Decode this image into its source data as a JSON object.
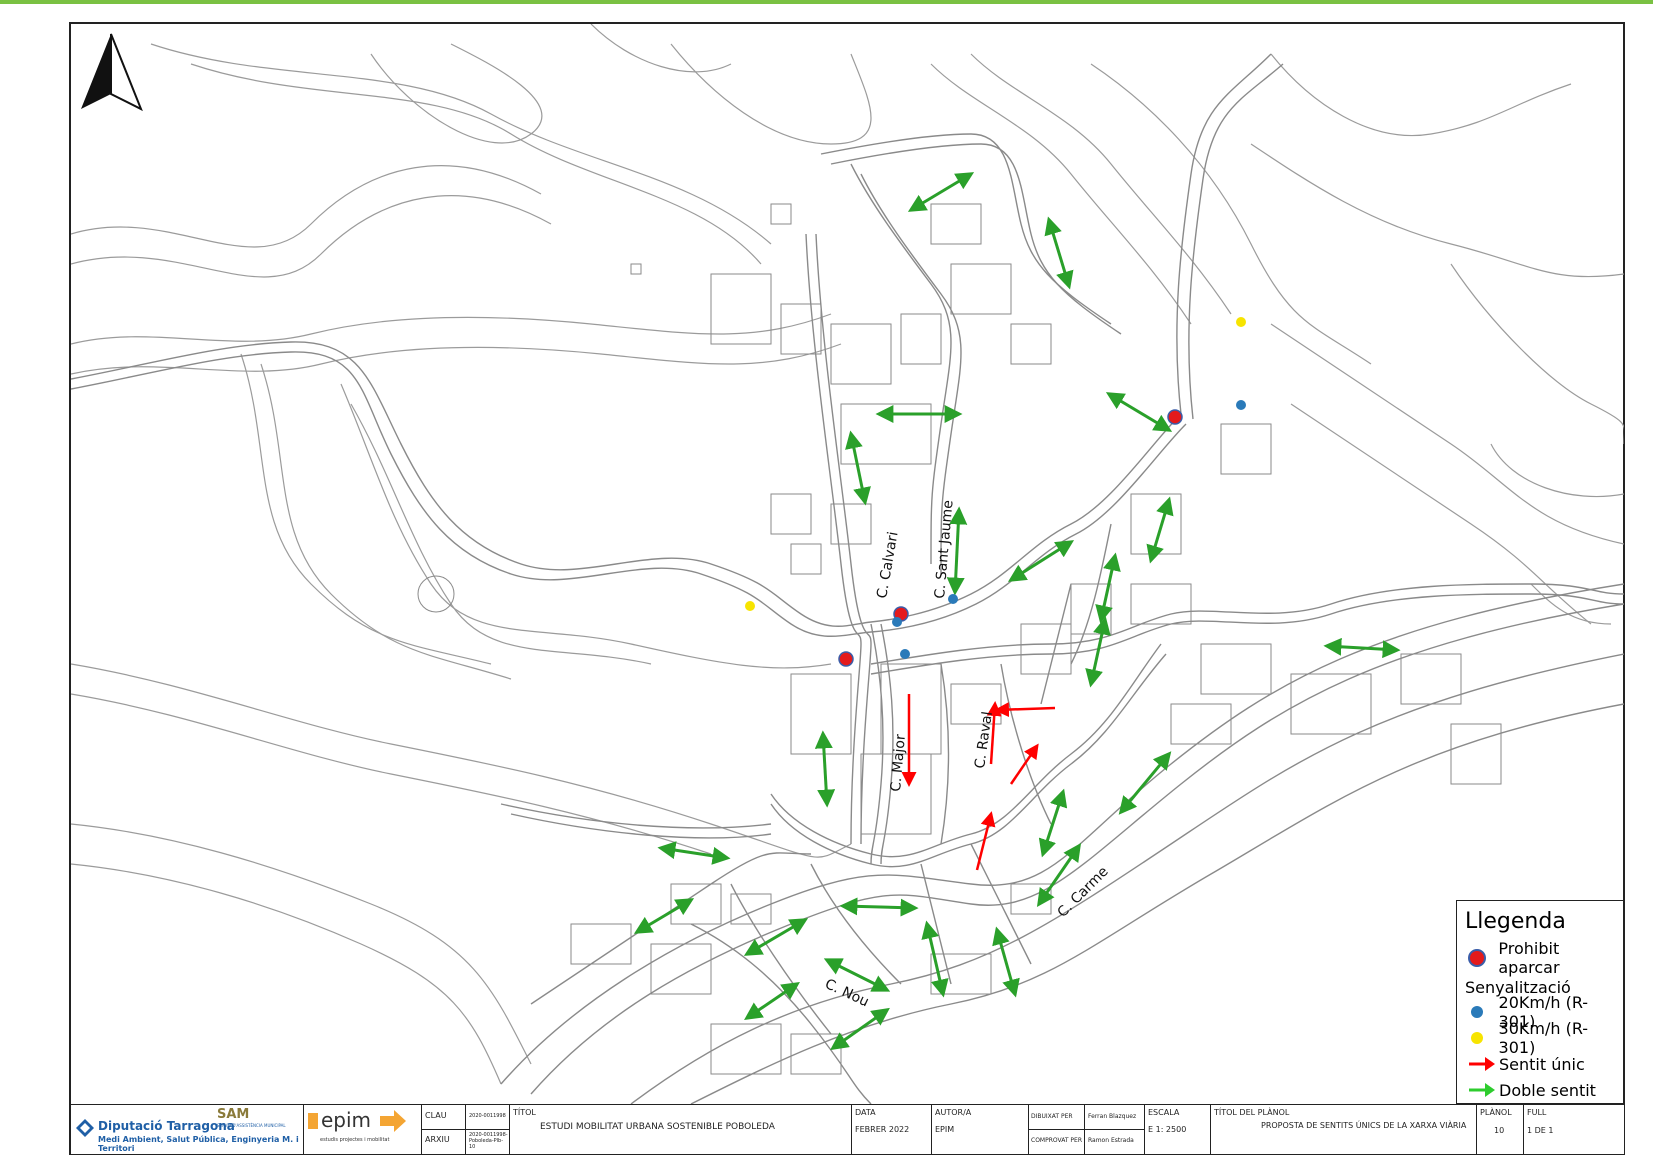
{
  "legend": {
    "title": "Llegenda",
    "items": [
      {
        "label": "Prohibit aparcar",
        "color": "#e41a1c"
      },
      {
        "label": "20Km/h (R-301)",
        "color": "#2a7ab9"
      },
      {
        "label": "30Km/h (R-301)",
        "color": "#f7e400"
      },
      {
        "label": "Sentit únic",
        "color": "#ff0000"
      },
      {
        "label": "Doble sentit",
        "color": "#2ecc2e"
      }
    ],
    "section_label": "Senyalització"
  },
  "streets": {
    "calvari": "C. Calvari",
    "sant_jaume": "C. Sant Jaume",
    "major": "C. Major",
    "raval": "C. Raval",
    "carme": "C. Carme",
    "nou": "C. Nou"
  },
  "titleblock": {
    "org_main": "Diputació Tarragona",
    "org_sam": "SAM",
    "org_sam_sub": "SERVEI D'ASSISTÈNCIA MUNICIPAL",
    "org_dept": "Medi Ambient, Salut Pública, Enginyeria M. i Territori",
    "epim_logo": "epim",
    "epim_sub": "estudis projectes i mobilitat",
    "clau_label": "CLAU",
    "clau_value": "2020-0011998",
    "arxiu_label": "ARXIU",
    "arxiu_value": "2020-0011998-Poboleda-Plb-10",
    "titol_label": "TÍTOL",
    "titol_value": "ESTUDI MOBILITAT URBANA SOSTENIBLE POBOLEDA",
    "data_label": "DATA",
    "data_value": "FEBRER 2022",
    "autor_label": "AUTOR/A",
    "autor_value": "EPIM",
    "dibuixat_label": "DIBUIXAT PER",
    "dibuixat_value": "Ferran Blazquez",
    "comprovat_label": "COMPROVAT PER",
    "comprovat_value": "Ramon Estrada",
    "escala_label": "ESCALA",
    "escala_value": "E 1: 2500",
    "titol_planol_label": "TÍTOL DEL PLÀNOL",
    "titol_planol_value": "PROPOSTA DE SENTITS ÚNICS DE LA XARXA VIÀRIA",
    "planol_label": "PLÀNOL",
    "planol_value": "10",
    "full_label": "FULL",
    "full_value": "1 DE 1"
  },
  "icons": [
    "north-arrow-icon",
    "prohibit-parking-icon",
    "speed-20-icon",
    "speed-30-icon",
    "one-way-arrow-icon",
    "two-way-arrow-icon"
  ]
}
